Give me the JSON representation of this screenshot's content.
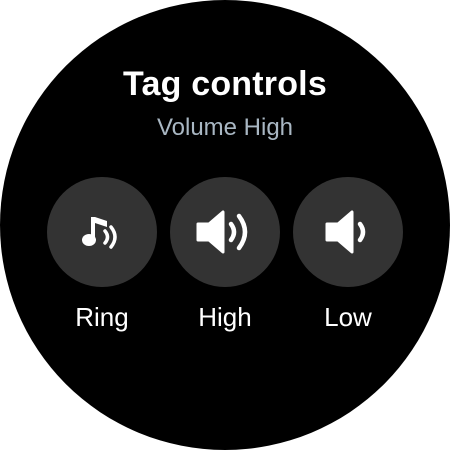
{
  "header": {
    "title": "Tag controls",
    "subtitle": "Volume High"
  },
  "controls": [
    {
      "label": "Ring",
      "icon": "music-note-ring-icon"
    },
    {
      "label": "High",
      "icon": "volume-high-icon"
    },
    {
      "label": "Low",
      "icon": "volume-low-icon"
    }
  ],
  "colors": {
    "background": "#000000",
    "button": "#333333",
    "title": "#ffffff",
    "subtitle": "#a9b7c3"
  }
}
